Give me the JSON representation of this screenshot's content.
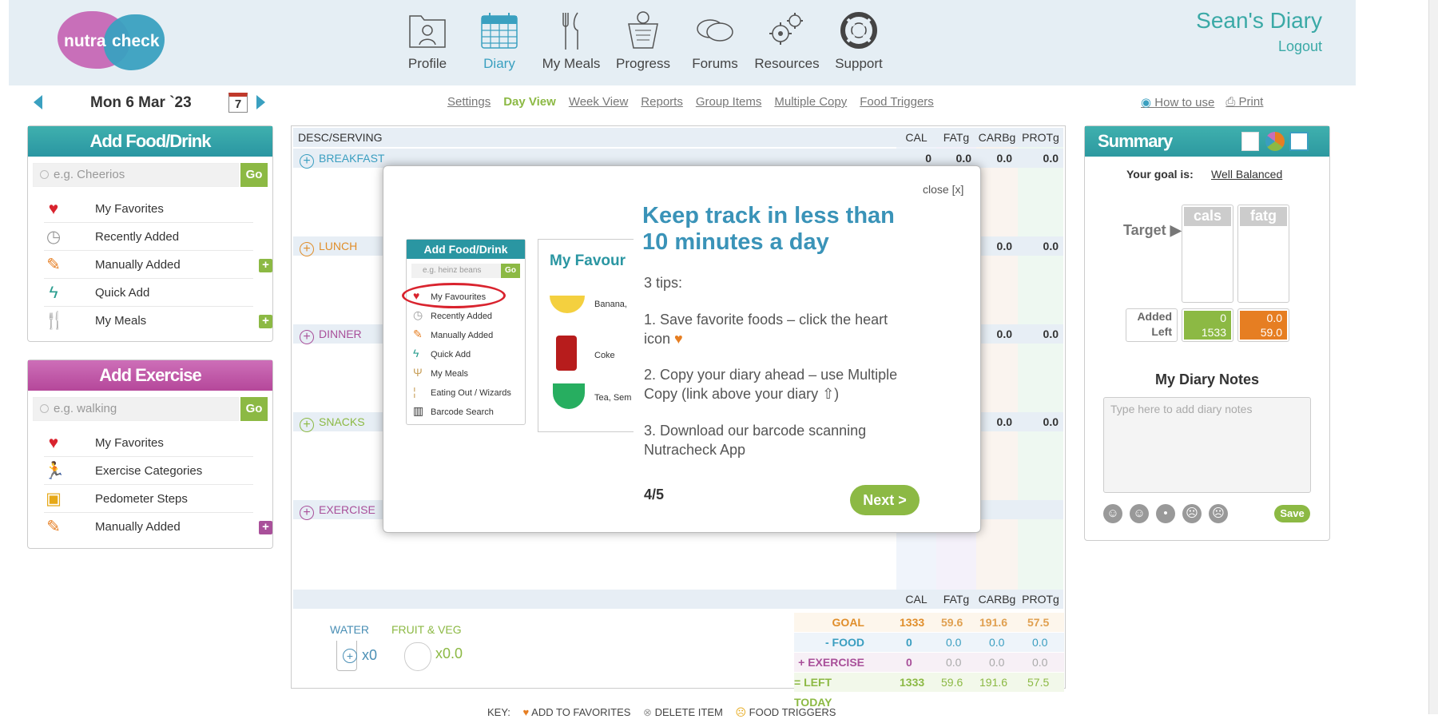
{
  "brand": {
    "logo_left": "nutra",
    "logo_right": "check"
  },
  "nav": {
    "items": [
      {
        "label": "Profile",
        "icon": "profile-icon"
      },
      {
        "label": "Diary",
        "icon": "calendar-icon"
      },
      {
        "label": "My Meals",
        "icon": "cutlery-icon"
      },
      {
        "label": "Progress",
        "icon": "scale-icon"
      },
      {
        "label": "Forums",
        "icon": "chat-icon"
      },
      {
        "label": "Resources",
        "icon": "gears-icon"
      },
      {
        "label": "Support",
        "icon": "lifebuoy-icon"
      }
    ]
  },
  "user": {
    "title": "Sean's Diary",
    "logout": "Logout"
  },
  "date": {
    "label": "Mon 6 Mar `23",
    "calendar_day": "7"
  },
  "subnav": [
    "Settings",
    "Day View",
    "Week View",
    "Reports",
    "Group Items",
    "Multiple Copy",
    "Food Triggers"
  ],
  "tools": {
    "how_to": "How to use",
    "print": "Print"
  },
  "add_food": {
    "title": "Add Food/Drink",
    "placeholder": "e.g. Cheerios",
    "go": "Go",
    "items": [
      "My Favorites",
      "Recently Added",
      "Manually Added",
      "Quick Add",
      "My Meals"
    ]
  },
  "add_exercise": {
    "title": "Add Exercise",
    "placeholder": "e.g. walking",
    "go": "Go",
    "items": [
      "My Favorites",
      "Exercise Categories",
      "Pedometer Steps",
      "Manually Added"
    ]
  },
  "diary": {
    "columns": {
      "desc": "DESC/SERVING",
      "cal": "CAL",
      "fat": "FATg",
      "carb": "CARBg",
      "prot": "PROTg"
    },
    "meals": [
      {
        "label": "BREAKFAST",
        "cal": "0",
        "fat": "0.0",
        "carb": "0.0",
        "prot": "0.0"
      },
      {
        "label": "LUNCH",
        "carb": "0.0",
        "prot": "0.0"
      },
      {
        "label": "DINNER",
        "carb": "0.0",
        "prot": "0.0"
      },
      {
        "label": "SNACKS",
        "carb": "0.0",
        "prot": "0.0"
      },
      {
        "label": "EXERCISE"
      }
    ],
    "water": {
      "label": "WATER",
      "count": "x0"
    },
    "fruit": {
      "label": "FRUIT & VEG",
      "count": "x0.0"
    },
    "totals": [
      {
        "label": "GOAL",
        "cal": "1333",
        "fat": "59.6",
        "carb": "191.6",
        "prot": "57.5"
      },
      {
        "label": "- FOOD",
        "cal": "0",
        "fat": "0.0",
        "carb": "0.0",
        "prot": "0.0"
      },
      {
        "label": "+ EXERCISE",
        "cal": "0",
        "fat": "0.0",
        "carb": "0.0",
        "prot": "0.0"
      },
      {
        "label": "= LEFT TODAY",
        "cal": "1333",
        "fat": "59.6",
        "carb": "191.6",
        "prot": "57.5"
      }
    ]
  },
  "summary": {
    "title": "Summary",
    "goal_label": "Your goal is:",
    "goal_value": "Well Balanced",
    "target": "Target",
    "cals": "cals",
    "fatg": "fatg",
    "added": "Added",
    "left": "Left",
    "cals_added": "0",
    "cals_left": "1533",
    "fat_added": "0.0",
    "fat_left": "59.0",
    "notes_title": "My Diary Notes",
    "notes_placeholder": "Type here to add diary notes",
    "save": "Save"
  },
  "modal": {
    "close": "close [x]",
    "title": "Keep track in less than 10 minutes a day",
    "intro": "3 tips:",
    "tip1": "1. Save favorite foods – click the heart icon",
    "tip2": "2. Copy your diary ahead – use Multiple Copy (link above your diary ⇧)",
    "tip3": "3. Download our barcode scanning Nutracheck App",
    "page": "4/5",
    "next": "Next >",
    "mini_header": "Add Food/Drink",
    "mini_placeholder": "e.g. heinz beans",
    "mini_go": "Go",
    "mini_items": [
      "My Favourites",
      "Recently Added",
      "Manually Added",
      "Quick Add",
      "My Meals",
      "Eating Out / Wizards",
      "Barcode Search"
    ],
    "fav_header": "My Favour",
    "fav_items": [
      "Banana,",
      "Coke",
      "Tea, Sem"
    ]
  },
  "key": {
    "label": "KEY:",
    "fav": "ADD TO FAVORITES",
    "del": "DELETE ITEM",
    "trig": "FOOD TRIGGERS"
  }
}
